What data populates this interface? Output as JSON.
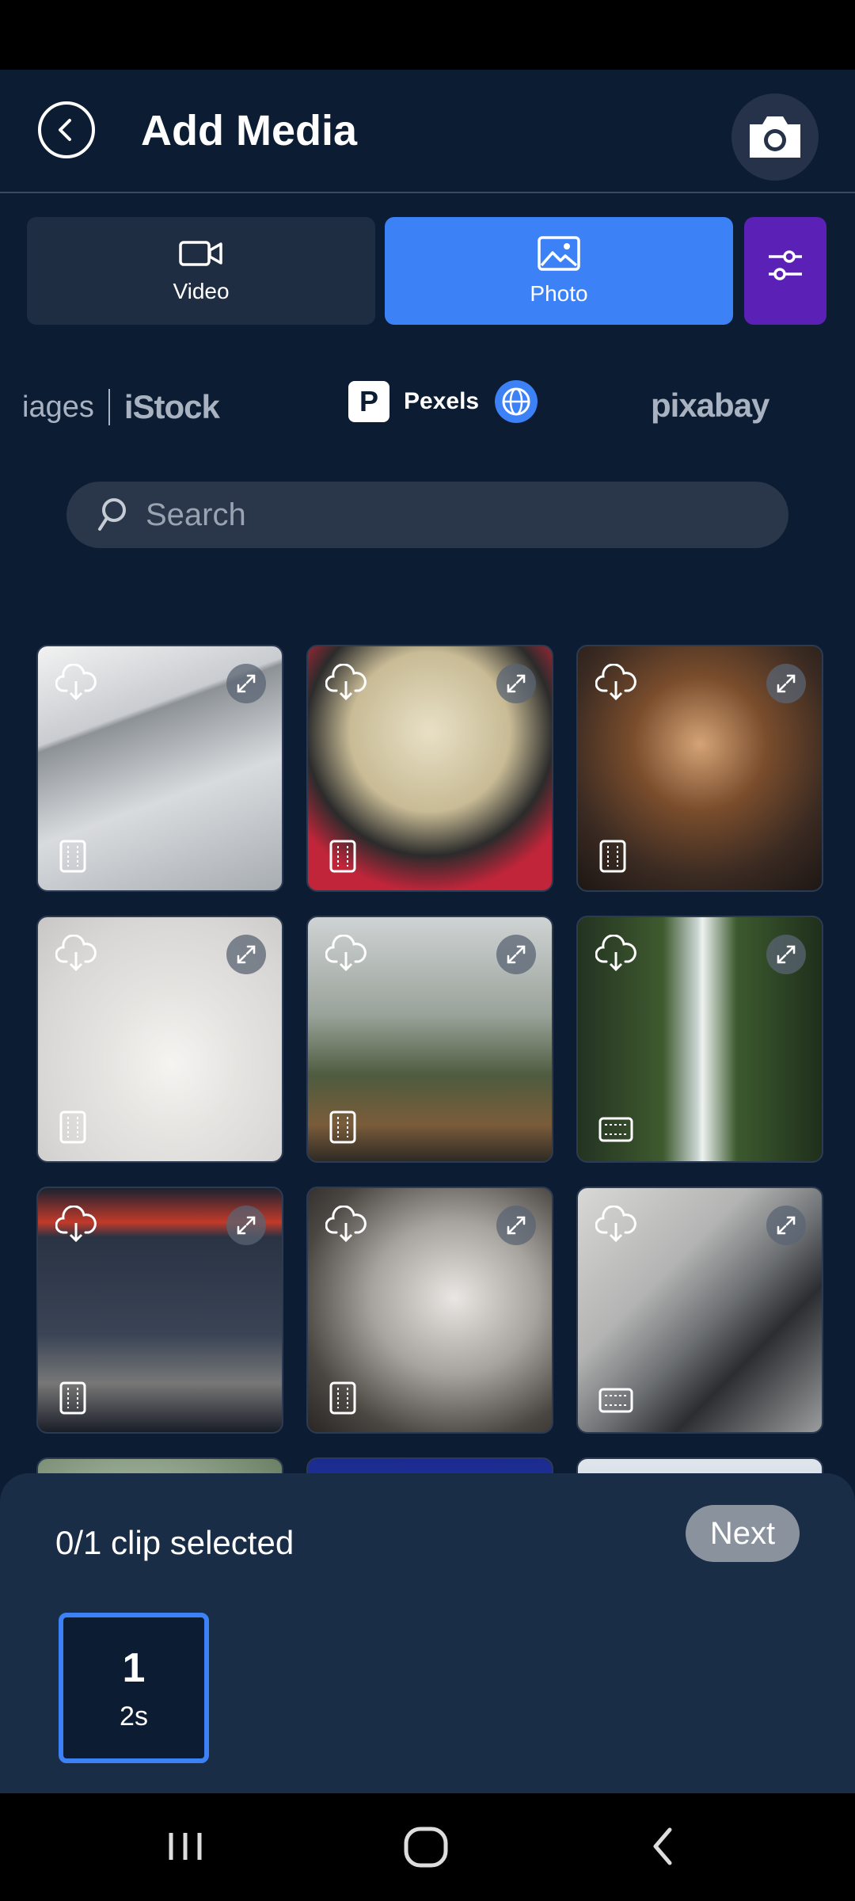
{
  "header": {
    "title": "Add Media"
  },
  "media_types": {
    "video_label": "Video",
    "photo_label": "Photo",
    "selected": "Photo"
  },
  "sources": {
    "istock_prefix": "iages",
    "istock_brand": "iStock",
    "pexels": "Pexels",
    "pixabay": "pixabay",
    "active": "Pexels"
  },
  "search": {
    "placeholder": "Search",
    "value": ""
  },
  "grid": {
    "tiles": [
      {
        "subject": "building",
        "format": "portrait"
      },
      {
        "subject": "straw-mask",
        "format": "portrait"
      },
      {
        "subject": "ornate-ceiling",
        "format": "portrait"
      },
      {
        "subject": "white-chair",
        "format": "portrait"
      },
      {
        "subject": "foggy-boardwalk",
        "format": "portrait"
      },
      {
        "subject": "waterfall",
        "format": "landscape"
      },
      {
        "subject": "gas-station-night",
        "format": "portrait"
      },
      {
        "subject": "wine-glass",
        "format": "portrait"
      },
      {
        "subject": "bicycle",
        "format": "landscape"
      },
      {
        "subject": "frosted-plant",
        "format": "portrait"
      },
      {
        "subject": "lightning",
        "format": "portrait"
      },
      {
        "subject": "mountains",
        "format": "portrait"
      }
    ]
  },
  "selection": {
    "status": "0/1 clip selected",
    "next_label": "Next",
    "slot_number": "1",
    "slot_duration": "2s"
  },
  "colors": {
    "accent": "#3c82f6",
    "filter": "#5b21b6",
    "background": "#0c1c33"
  }
}
